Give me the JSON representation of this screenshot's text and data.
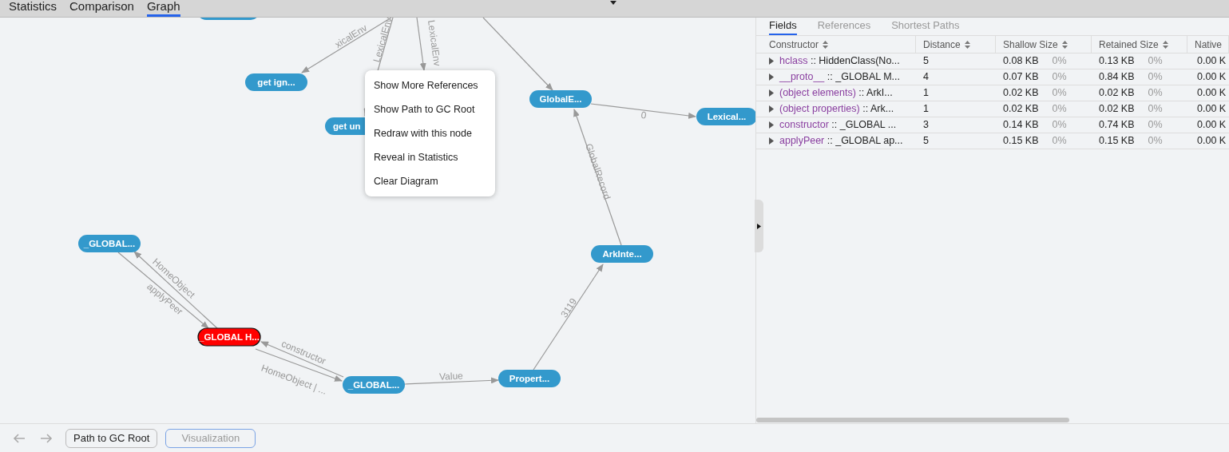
{
  "top_tabs": [
    {
      "label": "Statistics",
      "selected": false
    },
    {
      "label": "Comparison",
      "selected": false
    },
    {
      "label": "Graph",
      "selected": true
    }
  ],
  "graph": {
    "nodes": [
      {
        "selected": false
      },
      {
        "label": "get ign...",
        "selected": false
      },
      {
        "label": "get un",
        "selected": false
      },
      {
        "label": "GlobalE...",
        "selected": false
      },
      {
        "label": "Lexical...",
        "selected": false
      },
      {
        "label": "ArkInte...",
        "selected": false
      },
      {
        "label": "_GLOBAL...",
        "selected": false
      },
      {
        "label": "_GLOBAL H...",
        "selected": true
      },
      {
        "label": "_GLOBAL...",
        "selected": false
      },
      {
        "label": "Propert...",
        "selected": false
      }
    ],
    "edges": [
      {
        "label": "xicalEnv"
      },
      {
        "label": "LexicalEnv"
      },
      {
        "label": "LexicalEnv"
      },
      {
        "label": "0"
      },
      {
        "label": "GlobalRecord"
      },
      {
        "label": "3119"
      },
      {
        "label": "Value"
      },
      {
        "label": "applyPeer"
      },
      {
        "label": "HomeObject"
      },
      {
        "label": "constructor"
      },
      {
        "label": "HomeObject | ..."
      }
    ],
    "context_menu": [
      "Show More References",
      "Show Path to GC Root",
      "Redraw with this node",
      "Reveal in Statistics",
      "Clear Diagram"
    ]
  },
  "details": {
    "tabs": [
      {
        "label": "Fields",
        "selected": true
      },
      {
        "label": "References",
        "selected": false
      },
      {
        "label": "Shortest Paths",
        "selected": false
      }
    ],
    "columns": [
      "Constructor",
      "Distance",
      "Shallow Size",
      "Retained Size",
      "Native"
    ],
    "rows": [
      {
        "name": "hclass",
        "type": ":: HiddenClass(No...",
        "distance": "5",
        "shallow": "0.08 KB",
        "shallow_pct": "0%",
        "retained": "0.13 KB",
        "retained_pct": "0%",
        "native": "0.00 K",
        "expanded": false
      },
      {
        "name": "__proto__",
        "type": ":: _GLOBAL M...",
        "distance": "4",
        "shallow": "0.07 KB",
        "shallow_pct": "0%",
        "retained": "0.84 KB",
        "retained_pct": "0%",
        "native": "0.00 K",
        "expanded": false
      },
      {
        "name": "(object elements)",
        "type": ":: ArkI...",
        "distance": "1",
        "shallow": "0.02 KB",
        "shallow_pct": "0%",
        "retained": "0.02 KB",
        "retained_pct": "0%",
        "native": "0.00 K",
        "expanded": false
      },
      {
        "name": "(object properties)",
        "type": ":: Ark...",
        "distance": "1",
        "shallow": "0.02 KB",
        "shallow_pct": "0%",
        "retained": "0.02 KB",
        "retained_pct": "0%",
        "native": "0.00 K",
        "expanded": false
      },
      {
        "name": "constructor",
        "type": ":: _GLOBAL ...",
        "distance": "3",
        "shallow": "0.14 KB",
        "shallow_pct": "0%",
        "retained": "0.74 KB",
        "retained_pct": "0%",
        "native": "0.00 K",
        "expanded": false
      },
      {
        "name": "applyPeer",
        "type": ":: _GLOBAL ap...",
        "distance": "5",
        "shallow": "0.15 KB",
        "shallow_pct": "0%",
        "retained": "0.15 KB",
        "retained_pct": "0%",
        "native": "0.00 K",
        "expanded": false
      }
    ]
  },
  "bottom_bar": {
    "buttons": [
      {
        "label": "Path to GC Root",
        "selected": false
      },
      {
        "label": "Visualization",
        "selected": true
      }
    ]
  }
}
